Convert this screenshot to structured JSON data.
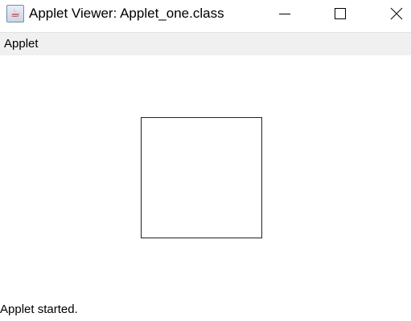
{
  "window": {
    "title": "Applet Viewer: Applet_one.class",
    "icon": "java-cup-icon",
    "controls": {
      "minimize_icon": "minimize-icon",
      "maximize_icon": "maximize-icon",
      "close_icon": "close-icon"
    }
  },
  "menubar": {
    "items": [
      {
        "label": "Applet"
      }
    ]
  },
  "canvas": {
    "shape": "square",
    "stroke_color": "#222222",
    "fill_color": "#ffffff"
  },
  "status": {
    "text": "Applet started."
  },
  "colors": {
    "menubar_bg": "#f0f0f0",
    "window_bg": "#ffffff"
  }
}
